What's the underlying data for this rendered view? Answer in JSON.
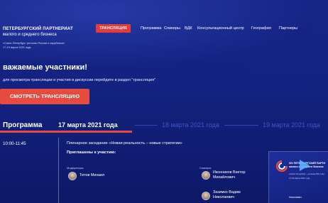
{
  "brand": {
    "title": "ПЕТЕРБУРГСКИЙ ПАРТНЕРИАТ",
    "subtitle": "малого и среднего бизнеса",
    "meta_line1": "«Санкт-Петербург: регионы России и зарубежья»",
    "meta_line2": "17-19 марта 2021 года"
  },
  "nav": {
    "items": [
      {
        "label": "ТРАНСЛЯЦИЯ",
        "active": true
      },
      {
        "label": "Программа",
        "active": false
      },
      {
        "label": "Спикеры",
        "active": false
      },
      {
        "label": "ВДК",
        "active": false
      },
      {
        "label": "Консультационный центр",
        "active": false
      },
      {
        "label": "География",
        "active": false
      },
      {
        "label": "Партнеры",
        "active": false
      }
    ]
  },
  "hero": {
    "heading": "важаемые участники!",
    "text": "для просмотра трансляции и участия в дискуссии перейдите в раздел \"трансляция\"",
    "cta_label": "СМОТРЕТЬ ТРАНСЛЯЦИЮ"
  },
  "program": {
    "label": "Программа",
    "tabs": [
      {
        "label": "17 марта 2021 года",
        "active": true
      },
      {
        "label": "18 марта 2021 года",
        "active": false
      },
      {
        "label": "19 марта 2021 года",
        "active": false
      }
    ]
  },
  "session": {
    "time": "10:00-11:45",
    "title": "Пленарное заседание «Новая реальность – новые стратегии»",
    "invited_label": "Приглашены к участию:",
    "moderators_label": "Модераторы",
    "speakers_label": "Спикеры",
    "moderator": {
      "name": "Титов Михаил"
    },
    "speakers": [
      {
        "name_line1": "Иконников Виктор",
        "name_line2": "Михайлович"
      },
      {
        "name_line1": "Зазимко Вадим",
        "name_line2": "Николаевич"
      }
    ]
  },
  "video": {
    "title_line1": "XIV ПЕТЕРБУРГСКИЙ ПАРТН",
    "title_line2": "малого и среднего бизнеса",
    "text_line1": "«Санкт-Петербург – регионы РФ и зар",
    "text_line2": "17-19 марта 2021 года",
    "bottom_text": "Николаевич"
  }
}
